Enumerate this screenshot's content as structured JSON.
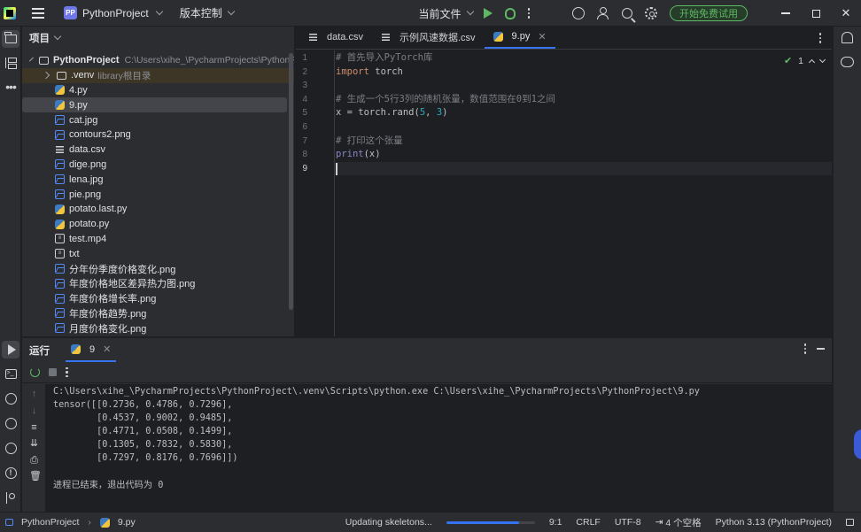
{
  "titlebar": {
    "project_badge": "PP",
    "project_name": "PythonProject",
    "vcs_label": "版本控制",
    "run_config": "当前文件",
    "trial_button": "开始免费试用"
  },
  "project_panel": {
    "title": "项目",
    "root": {
      "name": "PythonProject",
      "path": "C:\\Users\\xihe_\\PycharmProjects\\PythonProject"
    },
    "venv": {
      "name": ".venv",
      "note": "library根目录"
    },
    "files": [
      {
        "name": "4.py",
        "type": "py"
      },
      {
        "name": "9.py",
        "type": "py",
        "selected": true
      },
      {
        "name": "cat.jpg",
        "type": "img"
      },
      {
        "name": "contours2.png",
        "type": "img"
      },
      {
        "name": "data.csv",
        "type": "csv"
      },
      {
        "name": "dige.png",
        "type": "img"
      },
      {
        "name": "lena.jpg",
        "type": "img"
      },
      {
        "name": "pie.png",
        "type": "img"
      },
      {
        "name": "potato.last.py",
        "type": "py"
      },
      {
        "name": "potato.py",
        "type": "py"
      },
      {
        "name": "test.mp4",
        "type": "txt"
      },
      {
        "name": "txt",
        "type": "txt"
      },
      {
        "name": "分年份季度价格变化.png",
        "type": "img"
      },
      {
        "name": "年度价格地区差异热力图.png",
        "type": "img"
      },
      {
        "name": "年度价格增长率.png",
        "type": "img"
      },
      {
        "name": "年度价格趋势.png",
        "type": "img"
      },
      {
        "name": "月度价格变化.png",
        "type": "img"
      }
    ]
  },
  "editor": {
    "tabs": [
      {
        "label": "data.csv",
        "icon": "csv-file-icon"
      },
      {
        "label": "示例风速数据.csv",
        "icon": "csv-file-icon"
      },
      {
        "label": "9.py",
        "icon": "python-file-icon",
        "active": true
      }
    ],
    "inspection_count": "1",
    "line_numbers": [
      "1",
      "2",
      "3",
      "4",
      "5",
      "6",
      "7",
      "8",
      "9"
    ],
    "code": {
      "l1": "# 首先导入PyTorch库",
      "l2_kw": "import",
      "l2_rest": " torch",
      "l4": "# 生成一个5行3列的随机张量，数值范围在0到1之间",
      "l5_a": "x = torch.rand(",
      "l5_n1": "5",
      "l5_b": ", ",
      "l5_n2": "3",
      "l5_c": ")",
      "l7": "# 打印这个张量",
      "l8_fn": "print",
      "l8_rest": "(x)"
    }
  },
  "run_panel": {
    "title": "运行",
    "tab_label": "9",
    "output": [
      "C:\\Users\\xihe_\\PycharmProjects\\PythonProject\\.venv\\Scripts\\python.exe C:\\Users\\xihe_\\PycharmProjects\\PythonProject\\9.py",
      "tensor([[0.2736, 0.4786, 0.7296],",
      "        [0.4537, 0.9002, 0.9485],",
      "        [0.4771, 0.0508, 0.1499],",
      "        [0.1305, 0.7832, 0.5830],",
      "        [0.7297, 0.8176, 0.7696]])",
      "",
      "进程已结束，退出代码为 0"
    ]
  },
  "statusbar": {
    "project": "PythonProject",
    "file": "9.py",
    "task": "Updating skeletons...",
    "progress": 0.82,
    "position": "9:1",
    "line_sep": "CRLF",
    "encoding": "UTF-8",
    "indent": "4 个空格",
    "interpreter": "Python 3.13 (PythonProject)"
  },
  "colors": {
    "accent": "#3574f0",
    "run_green": "#5fb865",
    "background": "#1e1f22",
    "panel": "#2b2d30"
  }
}
